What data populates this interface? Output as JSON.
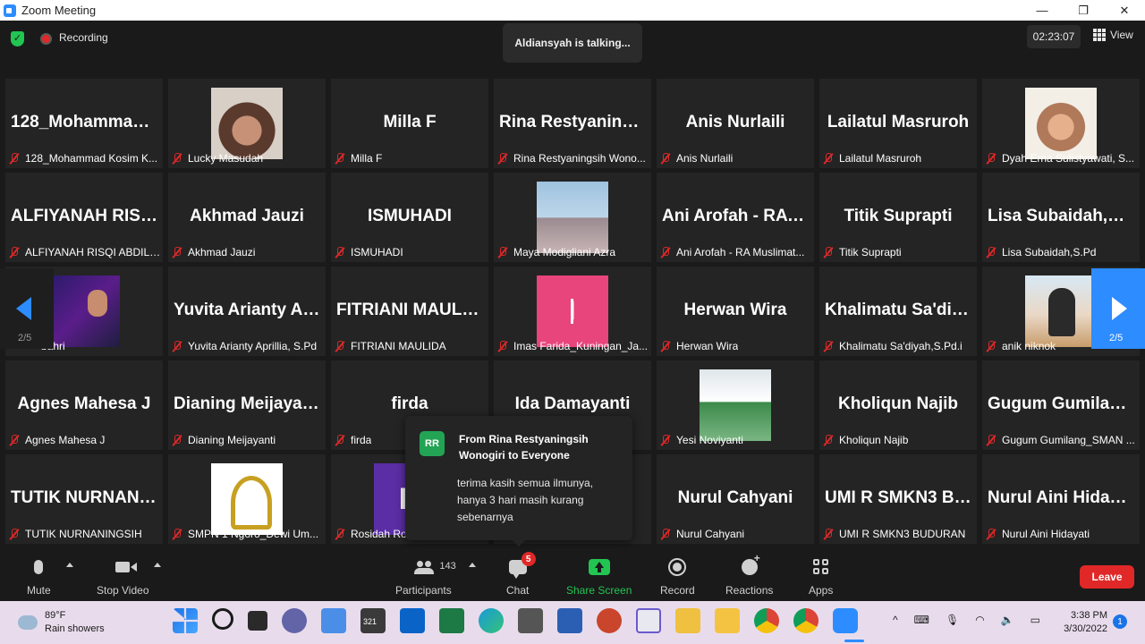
{
  "window": {
    "title": "Zoom Meeting",
    "minimize": "—",
    "maximize": "❐",
    "close": "✕"
  },
  "topbar": {
    "recording_label": "Recording",
    "talking_text": "Aldiansyah is talking...",
    "timer": "02:23:07",
    "view_label": "View"
  },
  "gallery": {
    "page_left": "2/5",
    "page_right": "2/5",
    "tiles": [
      {
        "big": "128_Mohammad Kosim K...",
        "name": "128_Mohammad Kosim K..."
      },
      {
        "big": "",
        "name": "Lucky Masudah"
      },
      {
        "big": "Milla F",
        "name": "Milla F"
      },
      {
        "big": "Rina Restyaningsih Wono...",
        "name": "Rina Restyaningsih Wono..."
      },
      {
        "big": "Anis Nurlaili",
        "name": "Anis Nurlaili"
      },
      {
        "big": "Lailatul Masruroh",
        "name": "Lailatul Masruroh"
      },
      {
        "big": "",
        "name": "Dyah Erna Sulistyawati, S..."
      },
      {
        "big": "ALFIYANAH RISQI ABDILL...",
        "name": "ALFIYANAH RISQI ABDILL..."
      },
      {
        "big": "Akhmad Jauzi",
        "name": "Akhmad Jauzi"
      },
      {
        "big": "ISMUHADI",
        "name": "ISMUHADI"
      },
      {
        "big": "",
        "name": "Maya Modigliani Azra"
      },
      {
        "big": "Ani Arofah - RA Muslimat...",
        "name": "Ani Arofah - RA Muslimat..."
      },
      {
        "big": "Titik Suprapti",
        "name": "Titik Suprapti"
      },
      {
        "big": "Lisa Subaidah,S.Pd",
        "name": "Lisa Subaidah,S.Pd"
      },
      {
        "big": "",
        "name": "bahri"
      },
      {
        "big": "Yuvita Arianty Aprillia, S.Pd",
        "name": "Yuvita Arianty Aprillia, S.Pd"
      },
      {
        "big": "FITRIANI MAULIDA",
        "name": "FITRIANI MAULIDA"
      },
      {
        "big": "",
        "name": "Imas Farida_Kuningan_Ja..."
      },
      {
        "big": "Herwan Wira",
        "name": "Herwan Wira"
      },
      {
        "big": "Khalimatu Sa'diyah,S.Pd.i",
        "name": "Khalimatu Sa'diyah,S.Pd.i"
      },
      {
        "big": "",
        "name": "anik niknok"
      },
      {
        "big": "Agnes Mahesa J",
        "name": "Agnes Mahesa J"
      },
      {
        "big": "Dianing Meijayanti",
        "name": "Dianing Meijayanti"
      },
      {
        "big": "firda",
        "name": "firda"
      },
      {
        "big": "Ida Damayanti",
        "name": ""
      },
      {
        "big": "",
        "name": "Yesi Noviyanti"
      },
      {
        "big": "Kholiqun Najib",
        "name": "Kholiqun Najib"
      },
      {
        "big": "Gugum Gumilang_SMAN ...",
        "name": "Gugum Gumilang_SMAN ..."
      },
      {
        "big": "TUTIK NURNANINGSIH",
        "name": "TUTIK NURNANINGSIH"
      },
      {
        "big": "",
        "name": "SMPN 1 Ngoro_Dewi Um..."
      },
      {
        "big": "",
        "name": "Rosidah Ro"
      },
      {
        "big": "",
        "name": ""
      },
      {
        "big": "Nurul Cahyani",
        "name": "Nurul Cahyani"
      },
      {
        "big": "UMI R SMKN3 BUDURAN",
        "name": "UMI R SMKN3 BUDURAN"
      },
      {
        "big": "Nurul Aini Hidayati",
        "name": "Nurul Aini Hidayati"
      }
    ],
    "imas_letter": "I",
    "rosidah_letter": "R"
  },
  "chat_popup": {
    "avatar": "RR",
    "from": "From Rina Restyaningsih Wonogiri to Everyone",
    "message": "terima kasih semua ilmunya, hanya 3 hari masih kurang sebenarnya"
  },
  "toolbar": {
    "mute": "Mute",
    "stop_video": "Stop Video",
    "participants_count": "143",
    "participants": "Participants",
    "chat": "Chat",
    "chat_badge": "5",
    "share_screen": "Share Screen",
    "record": "Record",
    "reactions": "Reactions",
    "apps": "Apps",
    "leave": "Leave"
  },
  "colors": {
    "accent": "#2d8cff",
    "share": "#23c552",
    "leave": "#e02828",
    "muted_mic": "#e02828"
  },
  "taskbar": {
    "weather_temp": "89°F",
    "weather_desc": "Rain showers",
    "calendar_day": "321",
    "time": "3:38 PM",
    "date": "3/30/2022",
    "notifications": "1",
    "tray_chevron": "^"
  }
}
